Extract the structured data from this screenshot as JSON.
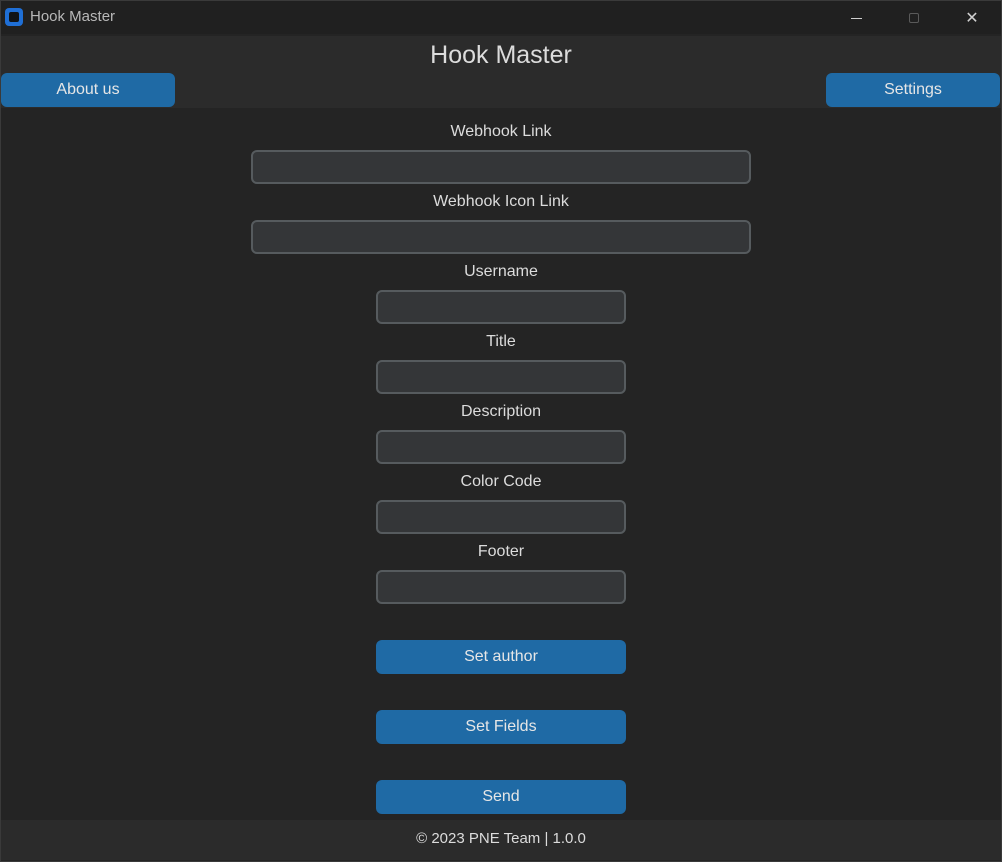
{
  "window": {
    "title": "Hook Master",
    "controls": {
      "minimize": "minimize",
      "maximize": "maximize",
      "close": "✕"
    }
  },
  "header": {
    "title": "Hook Master",
    "about_label": "About us",
    "settings_label": "Settings"
  },
  "form": {
    "fields": [
      {
        "label": "Webhook Link",
        "value": ""
      },
      {
        "label": "Webhook Icon Link",
        "value": ""
      },
      {
        "label": "Username",
        "value": ""
      },
      {
        "label": "Title",
        "value": ""
      },
      {
        "label": "Description",
        "value": ""
      },
      {
        "label": "Color Code",
        "value": ""
      },
      {
        "label": "Footer",
        "value": ""
      }
    ],
    "buttons": {
      "set_author": "Set author",
      "set_fields": "Set Fields",
      "send": "Send"
    }
  },
  "footer": {
    "text": "© 2023 PNE Team | 1.0.0"
  },
  "colors": {
    "accent": "#1f6aa5",
    "background": "#242424",
    "panel": "#2b2b2b",
    "field": "#343638",
    "field_border": "#565b5e",
    "text": "#dcdcdc"
  }
}
